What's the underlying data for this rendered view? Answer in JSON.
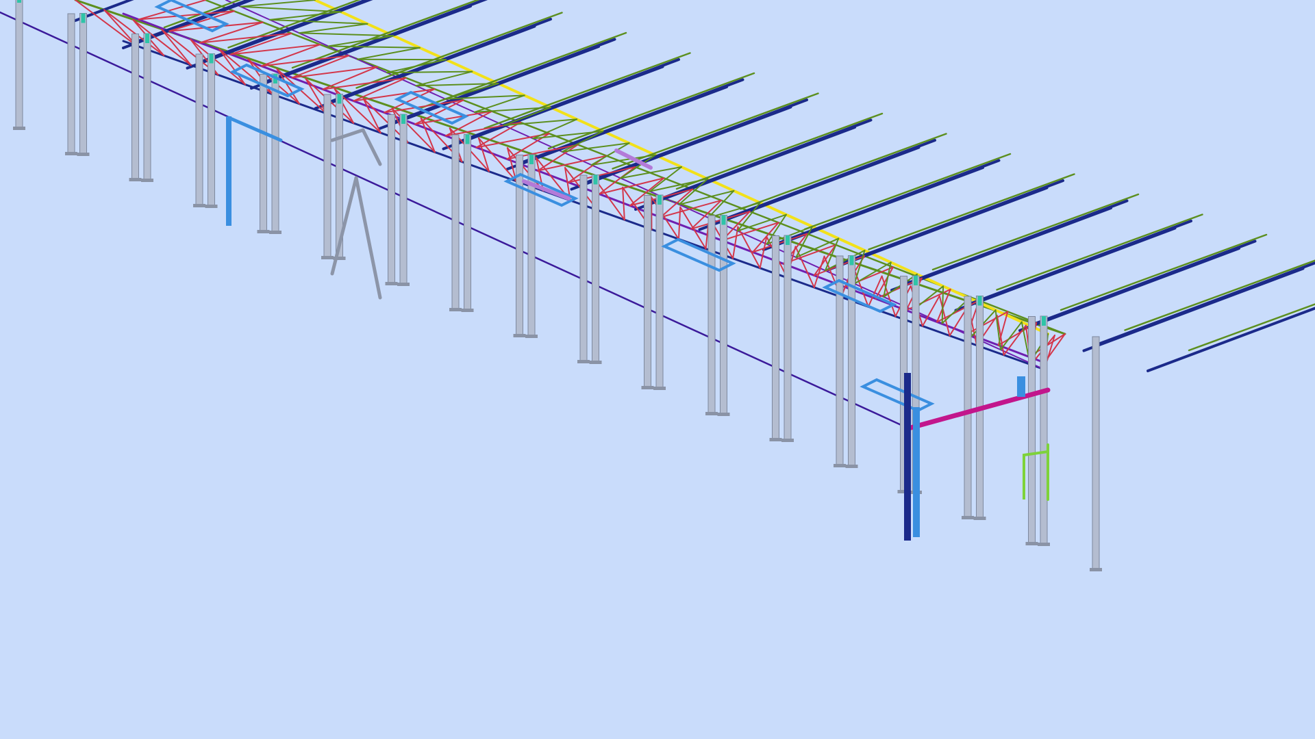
{
  "viewport": {
    "background": "#c9dcfb"
  },
  "model": {
    "bays": 17,
    "colors": {
      "column": "#b4bdd0",
      "column_shadow": "#7d889e",
      "base_plate": "#8a93a6",
      "bottom_chord": "#1b2a8a",
      "top_green": "#5c8f1e",
      "ridge_yellow": "#f2e11a",
      "truss_diag_red": "#d3364a",
      "brace_purple": "#6e1fb0",
      "eave_violet": "#3b1a9a",
      "opening_blue": "#3a8fe0",
      "magenta_beam": "#c2168c",
      "lilac_member": "#b37ad8",
      "cyan_cap": "#2fc4a8",
      "green_frame": "#7ed23a",
      "gray_kbrace": "#8c95a8"
    }
  }
}
